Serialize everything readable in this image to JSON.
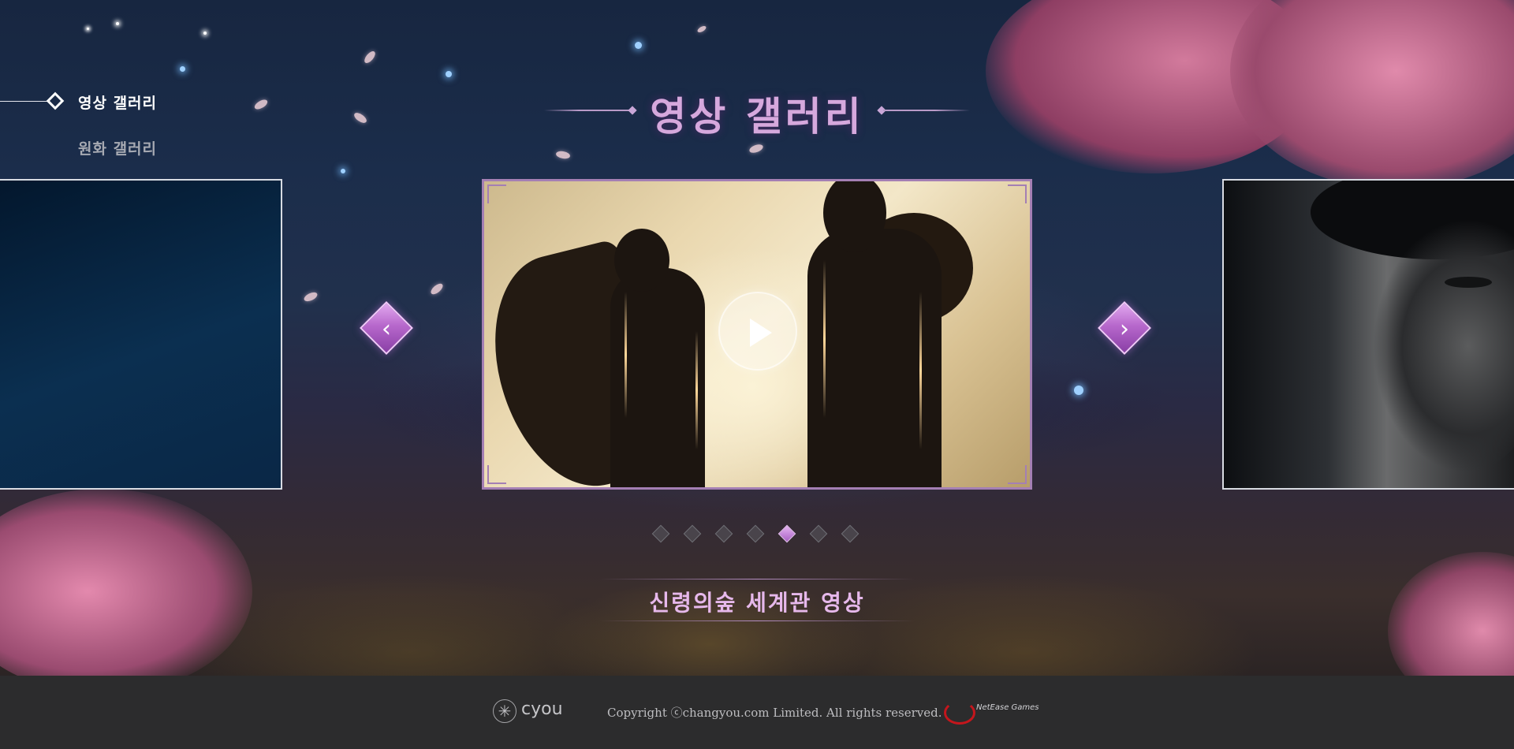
{
  "nav": {
    "items": [
      {
        "label": "영상 갤러리",
        "active": true
      },
      {
        "label": "원화 갤러리",
        "active": false
      }
    ]
  },
  "gallery": {
    "title": "영상 갤러리",
    "caption": "신령의숲 세계관 영상",
    "slide_count": 7,
    "active_slide_index": 4,
    "prev_glyph": "‹",
    "next_glyph": "›"
  },
  "footer": {
    "cyou_logo_text": "cyou",
    "copyright": "Copyright ⓒchangyou.com Limited. All rights reserved.",
    "netease_logo_text": "NetEase Games"
  },
  "colors": {
    "accent_purple": "#b768cc",
    "title_pink": "#d6a8dd",
    "footer_bg": "#2c2c2d"
  },
  "icons": {
    "nav_marker": "diamond-outline-icon",
    "play": "play-icon",
    "prev": "chevron-left-icon",
    "next": "chevron-right-icon",
    "cyou": "cyou-flower-logo",
    "netease": "netease-logo"
  }
}
